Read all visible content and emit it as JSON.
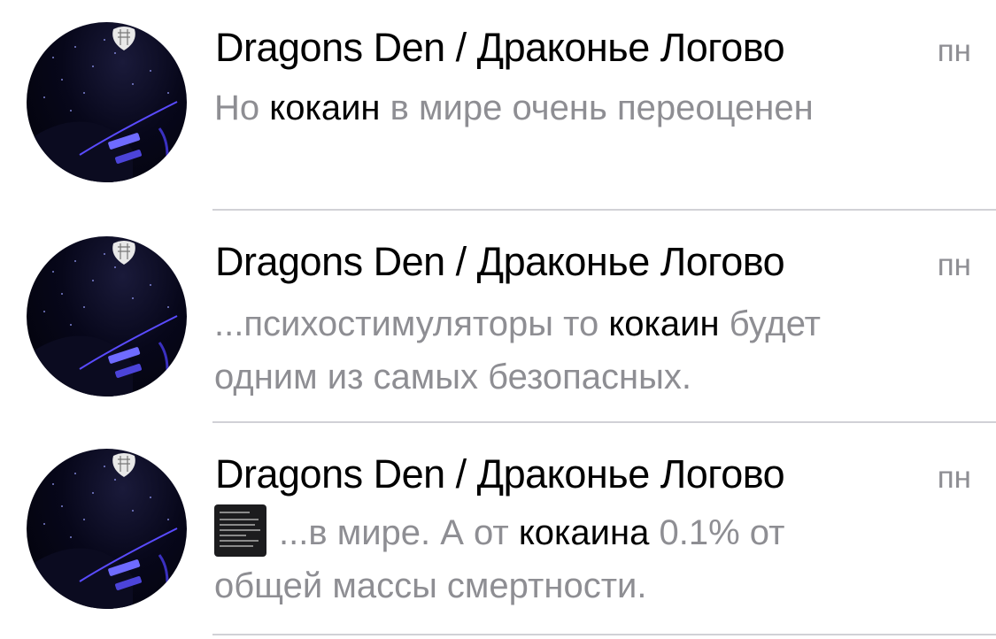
{
  "results": [
    {
      "title": "Dragons Den / Драконье Логово",
      "date": "пн",
      "has_thumbnail": false,
      "snippet": {
        "line1": {
          "before": "Но ",
          "highlight": "кокаин",
          "after": " в мире очень переоценен"
        },
        "line2": ""
      }
    },
    {
      "title": "Dragons Den / Драконье Логово",
      "date": "пн",
      "has_thumbnail": false,
      "snippet": {
        "line1": {
          "before": "...психостимуляторы то ",
          "highlight": "кокаин",
          "after": " будет"
        },
        "line2": "одним из самых безопасных."
      }
    },
    {
      "title": "Dragons Den / Драконье Логово",
      "date": "пн",
      "has_thumbnail": true,
      "snippet": {
        "line1": {
          "before": "...в мире. А от ",
          "highlight": "кокаина",
          "after": " 0.1% от"
        },
        "line2": "общей массы смертности."
      }
    }
  ],
  "colors": {
    "title": "#000000",
    "secondary": "#8e8e93",
    "highlight": "#000000",
    "separator": "#d1d1d6"
  }
}
